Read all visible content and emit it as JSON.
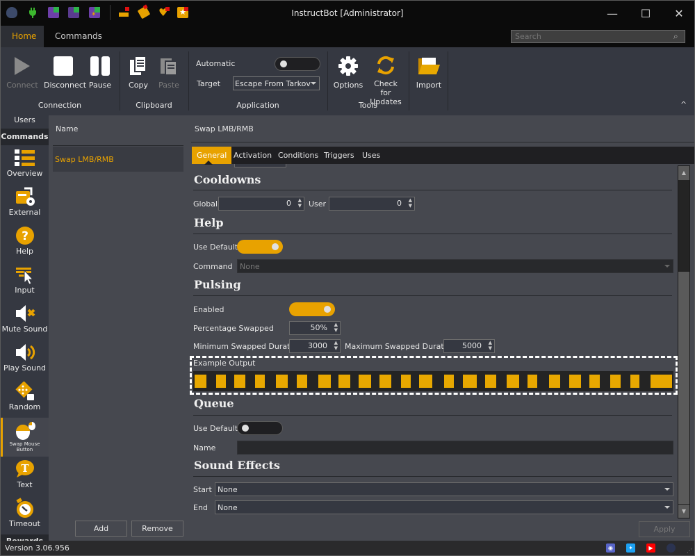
{
  "window": {
    "title": "InstructBot [Administrator]",
    "controls": {
      "minimize": "—",
      "maximize": "☐",
      "close": "✕"
    }
  },
  "quick_access": [
    "app-logo-icon",
    "connect-plug-icon",
    "twitch-streamer-icon",
    "twitch-bot-icon",
    "twitch-bits-icon",
    "points-icon",
    "tag-icon",
    "heart-icon",
    "star-icon"
  ],
  "ribbon_tabs": [
    {
      "label": "Home",
      "active": true
    },
    {
      "label": "Commands",
      "active": false
    }
  ],
  "search": {
    "placeholder": "Search",
    "value": ""
  },
  "ribbon": {
    "groups": [
      {
        "label": "Connection",
        "buttons": [
          {
            "label": "Connect",
            "enabled": false
          },
          {
            "label": "Disconnect",
            "enabled": true
          },
          {
            "label": "Pause",
            "enabled": true
          }
        ]
      },
      {
        "label": "Clipboard",
        "buttons": [
          {
            "label": "Copy",
            "enabled": true
          },
          {
            "label": "Paste",
            "enabled": false
          }
        ]
      },
      {
        "label": "Application",
        "automatic_label": "Automatic",
        "automatic_on": false,
        "target_label": "Target",
        "target_value": "Escape From Tarkov"
      },
      {
        "label": "Tools",
        "buttons": [
          {
            "label": "Options",
            "enabled": true
          },
          {
            "label": "Check for Updates",
            "line1": "Check for",
            "line2": "Updates",
            "enabled": true
          }
        ]
      },
      {
        "label": "",
        "buttons": [
          {
            "label": "Import",
            "enabled": true
          }
        ]
      }
    ],
    "collapse": "^"
  },
  "leftnav": {
    "users": "Users",
    "commands": "Commands",
    "items": [
      {
        "label": "Overview",
        "icon": "overview-list-icon"
      },
      {
        "label": "External",
        "icon": "external-gear-icon"
      },
      {
        "label": "Help",
        "icon": "help-question-icon"
      },
      {
        "label": "Input",
        "icon": "keyboard-cursor-icon"
      },
      {
        "label": "Mute Sound",
        "icon": "mute-speaker-icon"
      },
      {
        "label": "Play Sound",
        "icon": "play-speaker-icon"
      },
      {
        "label": "Random",
        "icon": "dice-icon"
      },
      {
        "label": "Swap Mouse Button",
        "line1": "Swap Mouse",
        "line2": "Button",
        "icon": "mouse-swap-icon",
        "active": true
      },
      {
        "label": "Text",
        "icon": "text-bubble-icon"
      },
      {
        "label": "Timeout",
        "icon": "stopwatch-icon"
      }
    ],
    "more": "Rewards"
  },
  "list": {
    "header": "Name",
    "items": [
      "Swap LMB/RMB"
    ],
    "add": "Add",
    "remove": "Remove"
  },
  "detail": {
    "title": "Swap LMB/RMB",
    "tabs": [
      {
        "label": "General",
        "active": true
      },
      {
        "label": "Activation"
      },
      {
        "label": "Conditions"
      },
      {
        "label": "Triggers"
      },
      {
        "label": "Uses"
      }
    ],
    "cooldowns": {
      "heading": "Cooldowns",
      "global_label": "Global",
      "global_value": "0",
      "user_label": "User",
      "user_value": "0"
    },
    "help": {
      "heading": "Help",
      "use_default_label": "Use Default",
      "use_default_on": true,
      "command_label": "Command",
      "command_value": "None"
    },
    "pulsing": {
      "heading": "Pulsing",
      "enabled_label": "Enabled",
      "enabled_on": true,
      "pct_label": "Percentage Swapped",
      "pct_value": "50%",
      "min_label": "Minimum Swapped Duration",
      "min_value": "3000",
      "max_label": "Maximum Swapped Duration",
      "max_value": "5000",
      "example_label": "Example Output",
      "example_blocks": 23
    },
    "queue": {
      "heading": "Queue",
      "use_default_label": "Use Default",
      "use_default_on": false,
      "name_label": "Name",
      "name_value": ""
    },
    "sound_effects": {
      "heading": "Sound Effects",
      "start_label": "Start",
      "start_value": "None",
      "end_label": "End",
      "end_value": "None"
    },
    "apply": "Apply"
  },
  "status": {
    "version": "Version 3.06.956",
    "social": [
      "discord-icon",
      "twitter-icon",
      "youtube-icon",
      "app-logo-icon"
    ]
  },
  "colors": {
    "accent": "#e8a200",
    "panel": "#46484f",
    "ribbon": "#353841",
    "dark": "#0b0b0b"
  }
}
